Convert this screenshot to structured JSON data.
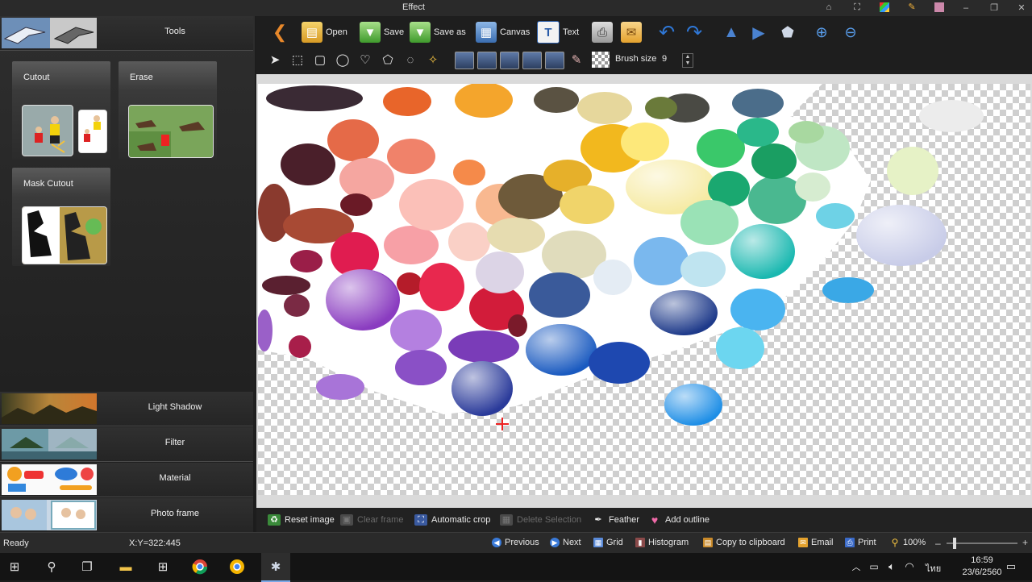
{
  "window": {
    "title": "Effect"
  },
  "left_panel": {
    "tools_label": "Tools",
    "cards": [
      {
        "label": "Cutout"
      },
      {
        "label": "Erase"
      },
      {
        "label": "Mask Cutout"
      }
    ],
    "categories": [
      {
        "label": "Light Shadow"
      },
      {
        "label": "Filter"
      },
      {
        "label": "Material"
      },
      {
        "label": "Photo frame"
      }
    ]
  },
  "toolbar": {
    "open": "Open",
    "save": "Save",
    "save_as": "Save as",
    "canvas": "Canvas",
    "text": "Text",
    "brush_size_label": "Brush size",
    "brush_size_value": "9"
  },
  "action_bar": {
    "reset_image": "Reset image",
    "clear_frame": "Clear frame",
    "automatic_crop": "Automatic crop",
    "delete_selection": "Delete Selection",
    "feather": "Feather",
    "add_outline": "Add outline"
  },
  "status_bar": {
    "status": "Ready",
    "coords": "X:Y=322:445",
    "previous": "Previous",
    "next": "Next",
    "grid": "Grid",
    "histogram": "Histogram",
    "copy_to_clipboard": "Copy to clipboard",
    "email": "Email",
    "print": "Print",
    "zoom": "100%"
  },
  "taskbar": {
    "time": "16:59",
    "date": "23/6/2560",
    "lang": "ไทย"
  },
  "colors": {
    "accent_blue": "#2f6fd6",
    "orange": "#e8882a"
  }
}
